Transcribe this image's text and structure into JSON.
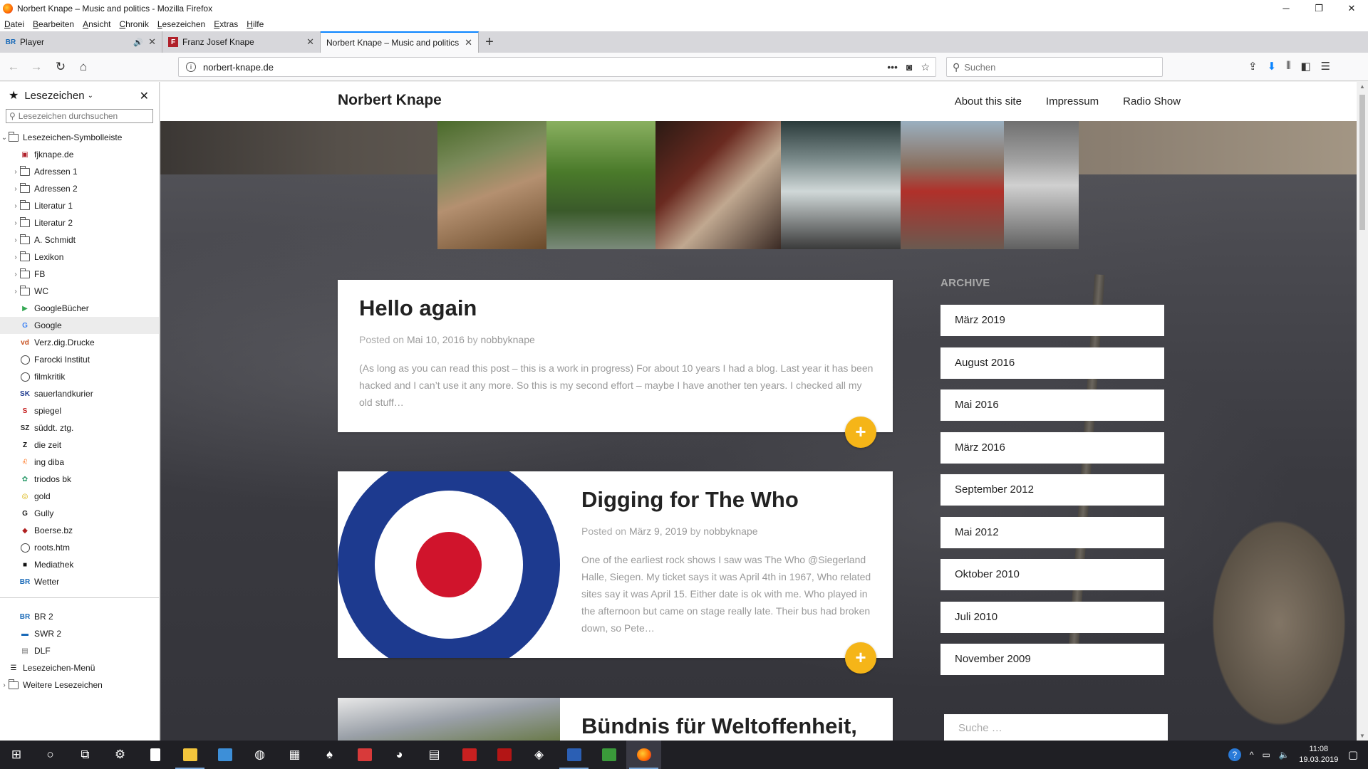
{
  "window": {
    "title": "Norbert Knape – Music and politics - Mozilla Firefox",
    "controls": [
      "─",
      "❐",
      "✕"
    ]
  },
  "menu": [
    "Datei",
    "Bearbeiten",
    "Ansicht",
    "Chronik",
    "Lesezeichen",
    "Extras",
    "Hilfe"
  ],
  "tabs": [
    {
      "label": "Player",
      "favicon": "BR"
    },
    {
      "label": "Franz Josef Knape",
      "favicon": "F"
    },
    {
      "label": "Norbert Knape – Music and politics",
      "favicon": ""
    }
  ],
  "nav": {
    "url": "norbert-knape.de",
    "search_placeholder": "Suchen"
  },
  "sidebar": {
    "title": "Lesezeichen",
    "search_placeholder": "Lesezeichen durchsuchen",
    "root": "Lesezeichen-Symbolleiste",
    "items": [
      {
        "label": "fjknape.de",
        "icon": "favicon-f",
        "color": "#b0202a"
      },
      {
        "label": "Adressen 1",
        "icon": "folder-icon"
      },
      {
        "label": "Adressen 2",
        "icon": "folder-icon"
      },
      {
        "label": "Literatur 1",
        "icon": "folder-icon"
      },
      {
        "label": "Literatur 2",
        "icon": "folder-icon"
      },
      {
        "label": "A. Schmidt",
        "icon": "folder-icon"
      },
      {
        "label": "Lexikon",
        "icon": "folder-icon"
      },
      {
        "label": "FB",
        "icon": "folder-icon"
      },
      {
        "label": "WC",
        "icon": "folder-icon"
      },
      {
        "label": "GoogleBücher",
        "icon": "play-icon",
        "color": "#34a853"
      },
      {
        "label": "Google",
        "icon": "google-icon",
        "color": "#4285f4"
      },
      {
        "label": "Verz.dig.Drucke",
        "icon": "vd-icon",
        "color": "#c8501e"
      },
      {
        "label": "Farocki Institut",
        "icon": "globe-icon"
      },
      {
        "label": "filmkritik",
        "icon": "globe-icon"
      },
      {
        "label": "sauerlandkurier",
        "icon": "sk-icon",
        "color": "#1d3a8f"
      },
      {
        "label": "spiegel",
        "icon": "s-icon",
        "color": "#c41a1a"
      },
      {
        "label": "süddt. ztg.",
        "icon": "sz-icon",
        "color": "#333333"
      },
      {
        "label": "die zeit",
        "icon": "z-icon",
        "color": "#111111"
      },
      {
        "label": "ing diba",
        "icon": "lion-icon",
        "color": "#ff6200"
      },
      {
        "label": "triodos bk",
        "icon": "triodos-icon",
        "color": "#2a9a6a"
      },
      {
        "label": "gold",
        "icon": "gold-icon",
        "color": "#d8b000"
      },
      {
        "label": "Gully",
        "icon": "g-icon",
        "color": "#222222"
      },
      {
        "label": "Boerse.bz",
        "icon": "shield-icon",
        "color": "#b02020"
      },
      {
        "label": "roots.htm",
        "icon": "globe-icon"
      },
      {
        "label": "Mediathek",
        "icon": "mediathek-icon",
        "color": "#111111"
      },
      {
        "label": "Wetter",
        "icon": "br-icon",
        "color": "#1a6ab8"
      }
    ],
    "items2": [
      {
        "label": "BR 2",
        "icon": "br-icon",
        "color": "#1a6ab8"
      },
      {
        "label": "SWR 2",
        "icon": "swr-icon",
        "color": "#1a6ab8"
      },
      {
        "label": "DLF",
        "icon": "page-icon",
        "color": "#777777"
      }
    ],
    "menu_item": "Lesezeichen-Menü",
    "more_item": "Weitere Lesezeichen"
  },
  "site": {
    "title": "Norbert Knape",
    "nav": [
      "About this site",
      "Impressum",
      "Radio Show"
    ],
    "posts": [
      {
        "title": "Hello again",
        "meta_prefix": "Posted on",
        "date": "Mai 10, 2016",
        "meta_by": "by",
        "author": "nobbyknape",
        "excerpt": "(As long as you can read this post – this is a work in progress) For about 10 years I had a blog. Last year it has been hacked and I can’t use it any more. So this is my second effort – maybe I have another ten years. I checked all my old stuff…"
      },
      {
        "title": "Digging for The Who",
        "meta_prefix": "Posted on",
        "date": "März 9, 2019",
        "meta_by": "by",
        "author": "nobbyknape",
        "excerpt": "One of the earliest rock shows I saw was The Who @Siegerland Halle, Siegen. My ticket says it was April 4th in 1967, Who related sites say it was April 15. Either date is ok with me. Who played in the afternoon but came on stage really late. Their bus had broken down, so Pete…"
      },
      {
        "title": "Bündnis für Weltoffenheit,"
      }
    ],
    "more_label": "+",
    "archive_title": "ARCHIVE",
    "archive": [
      "März 2019",
      "August 2016",
      "Mai 2016",
      "März 2016",
      "September 2012",
      "Mai 2012",
      "Oktober 2010",
      "Juli 2010",
      "November 2009"
    ],
    "search_placeholder": "Suche …"
  },
  "taskbar": {
    "time": "11:08",
    "date": "19.03.2019"
  }
}
